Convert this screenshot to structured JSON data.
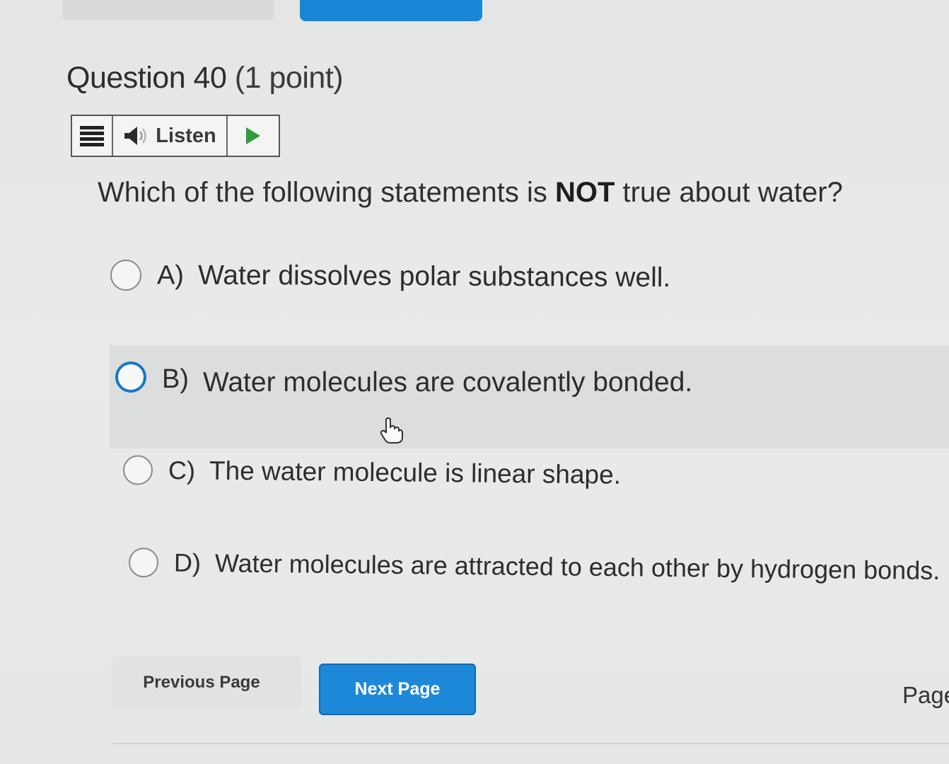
{
  "question": {
    "title": "Question 40",
    "points": "(1 point)",
    "prompt_before": "Which of the following statements is ",
    "prompt_emphasis": "NOT",
    "prompt_after": " true about water?"
  },
  "toolbar": {
    "listen_label": "Listen",
    "menu_icon": "hamburger-menu-icon",
    "speaker_icon": "speaker-icon",
    "play_icon": "play-icon",
    "play_color": "#2e9c3a"
  },
  "options": [
    {
      "letter": "A)",
      "text": "Water dissolves polar substances well."
    },
    {
      "letter": "B)",
      "text": "Water molecules are covalently bonded."
    },
    {
      "letter": "C)",
      "text": "The water molecule is linear shape."
    },
    {
      "letter": "D)",
      "text": "Water molecules are attracted to each other by hydrogen bonds."
    }
  ],
  "navigation": {
    "previous_label": "Previous Page",
    "next_label": "Next Page",
    "page_label": "Page"
  },
  "colors": {
    "accent": "#1e88d8",
    "radio_focus": "#1877c9"
  }
}
